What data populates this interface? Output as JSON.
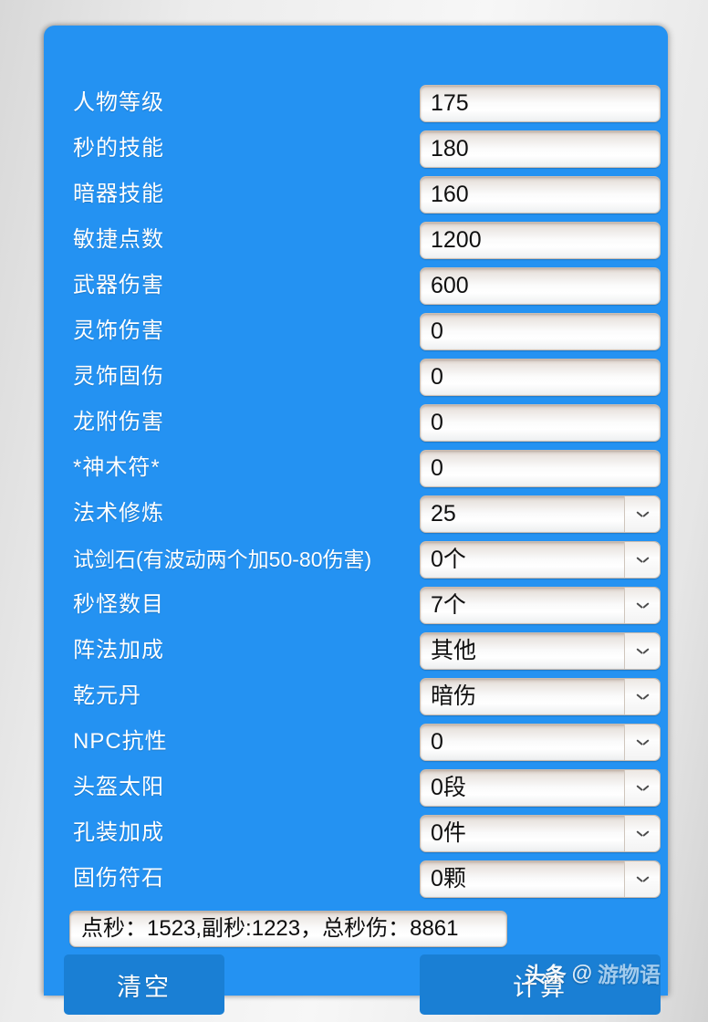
{
  "theme": {
    "panel_blue": "#2492f2",
    "button_blue": "#1a7fd4",
    "field_bg": "#ffffff",
    "label_color": "#ffffff",
    "value_color": "#101010"
  },
  "form": {
    "rows": [
      {
        "label": "人物等级",
        "type": "text",
        "value": "175"
      },
      {
        "label": "秒的技能",
        "type": "text",
        "value": "180"
      },
      {
        "label": "暗器技能",
        "type": "text",
        "value": "160"
      },
      {
        "label": "敏捷点数",
        "type": "text",
        "value": "1200"
      },
      {
        "label": "武器伤害",
        "type": "text",
        "value": "600"
      },
      {
        "label": "灵饰伤害",
        "type": "text",
        "value": "0"
      },
      {
        "label": "灵饰固伤",
        "type": "text",
        "value": "0"
      },
      {
        "label": "龙附伤害",
        "type": "text",
        "value": "0"
      },
      {
        "label": "*神木符*",
        "type": "text",
        "value": "0"
      },
      {
        "label": "法术修炼",
        "type": "select",
        "value": "25"
      },
      {
        "label": "试剑石(有波动两个加50-80伤害)",
        "type": "select",
        "value": "0个"
      },
      {
        "label": "秒怪数目",
        "type": "select",
        "value": "7个"
      },
      {
        "label": "阵法加成",
        "type": "select",
        "value": "其他"
      },
      {
        "label": "乾元丹",
        "type": "select",
        "value": "暗伤"
      },
      {
        "label": "NPC抗性",
        "type": "select",
        "value": "0"
      },
      {
        "label": "头盔太阳",
        "type": "select",
        "value": "0段"
      },
      {
        "label": "孔装加成",
        "type": "select",
        "value": "0件"
      },
      {
        "label": "固伤符石",
        "type": "select",
        "value": "0颗"
      }
    ]
  },
  "result": {
    "text": "点秒：1523,副秒:1223，总秒伤：8861"
  },
  "actions": {
    "clear_label": "清空",
    "calculate_label": "计算"
  },
  "watermark": {
    "source": "头条",
    "at": "@",
    "name": "游物语"
  }
}
